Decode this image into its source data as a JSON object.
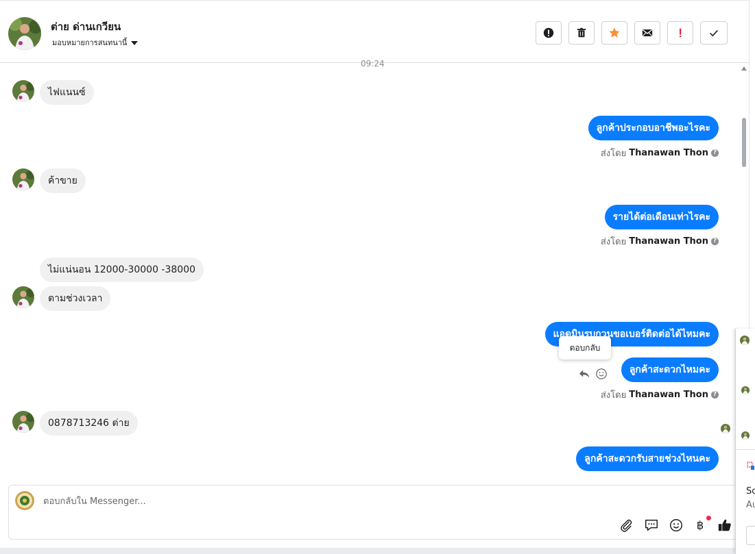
{
  "header": {
    "contact_name": "ต่าย ด่านเกวียน",
    "assign_label": "มอบหมายการสนทนานี้",
    "actions": [
      {
        "name": "spam",
        "icon": "alert-circle-icon"
      },
      {
        "name": "delete",
        "icon": "trash-icon"
      },
      {
        "name": "star",
        "icon": "star-icon",
        "color": "#f7923b"
      },
      {
        "name": "mark-unread",
        "icon": "envelope-icon"
      },
      {
        "name": "important",
        "icon": "exclamation-icon",
        "color": "#e41e3f"
      },
      {
        "name": "done",
        "icon": "check-icon"
      }
    ]
  },
  "thread": {
    "timestamp": "09:24",
    "messages": [
      {
        "side": "in",
        "text": "ไฟแนนซ์"
      },
      {
        "side": "out",
        "text": "ลูกค้าประกอบอาชีพอะไรคะ"
      },
      {
        "side": "in",
        "text": "ค้าขาย"
      },
      {
        "side": "out",
        "text": "รายได้ต่อเดือนเท่าไรคะ"
      },
      {
        "side": "in",
        "text": "ไม่แน่นอน 12000-30000 -38000"
      },
      {
        "side": "in",
        "text": "ตามช่วงเวลา"
      },
      {
        "side": "out",
        "text": "แอดมินรบกวนขอเบอร์ติดต่อได้ไหมคะ"
      },
      {
        "side": "out",
        "text": "ลูกค้าสะดวกไหมคะ"
      },
      {
        "side": "in",
        "text": "0878713246 ต่าย"
      },
      {
        "side": "out",
        "text": "ลูกค้าสะดวกรับสายช่วงไหนคะ"
      }
    ],
    "sent_by_prefix": "ส่งโดย",
    "sent_by_name": "Thanawan Thon",
    "tooltip": "ตอบกลับ"
  },
  "composer": {
    "placeholder": "ตอบกลับใน Messenger...",
    "tools": [
      "paperclip-icon",
      "speech-bubble-icon",
      "smiley-icon",
      "baht-icon",
      "thumbs-up-icon"
    ]
  },
  "side_panel": {
    "line1": "So",
    "line2": "Au"
  },
  "colors": {
    "accent": "#0a7cff",
    "incoming_bubble": "#f0f0f0",
    "like": "#1c1e21"
  }
}
